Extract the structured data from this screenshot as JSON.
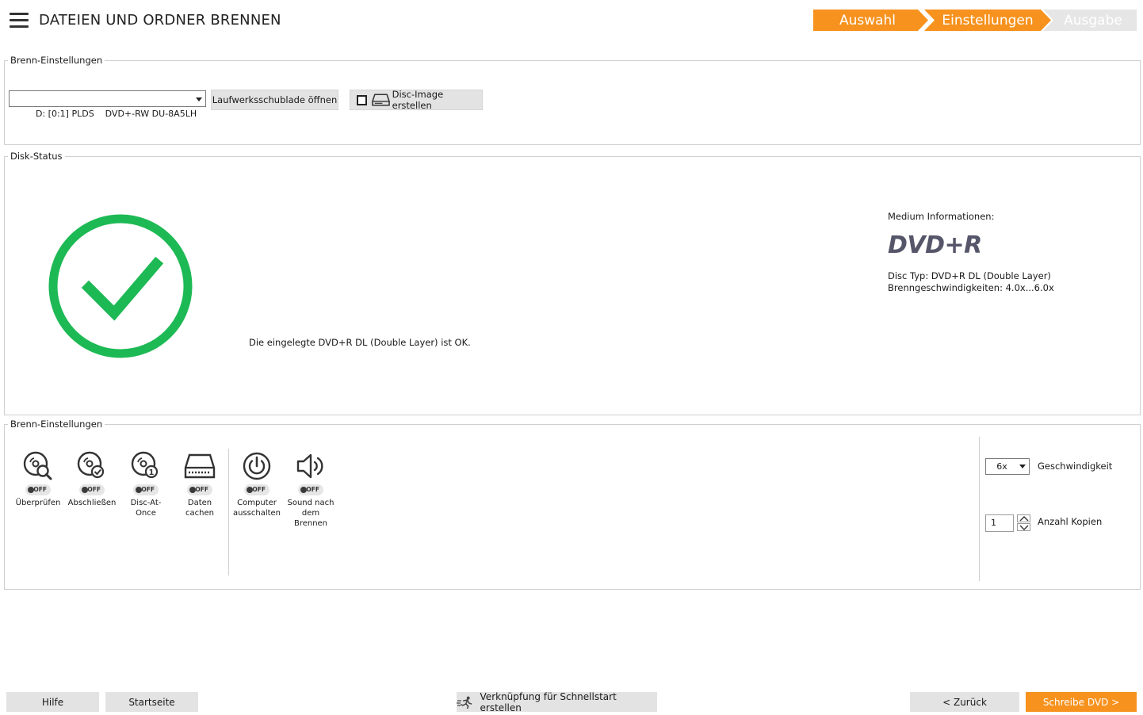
{
  "header": {
    "title": "DATEIEN UND ORDNER BRENNEN",
    "steps": [
      {
        "label": "Auswahl",
        "color": "#f7921e",
        "text_color": "#ffffff"
      },
      {
        "label": "Einstellungen",
        "color": "#f7921e",
        "text_color": "#ffffff"
      },
      {
        "label": "Ausgabe",
        "color": "#e6e6e6",
        "text_color": "#ffffff"
      }
    ]
  },
  "burn_settings_top": {
    "legend": "Brenn-Einstellungen",
    "drive": "D: [0:1] PLDS    DVD+-RW DU-8A5LH",
    "tray_button": "Laufwerksschublade öffnen",
    "disc_image_label": "Disc-Image erstellen",
    "disc_image_checked": false
  },
  "disk_status": {
    "legend": "Disk-Status",
    "ok_color": "#1db954",
    "message": "Die eingelegte DVD+R DL (Double Layer) ist OK.",
    "medium_title": "Medium Informationen:",
    "medium_type": "DVD+R",
    "disc_type": "Disc Typ: DVD+R DL (Double Layer)",
    "speeds": "Brenngeschwindigkeiten: 4.0x...6.0x"
  },
  "burn_settings_bottom": {
    "legend": "Brenn-Einstellungen",
    "options": [
      {
        "icon": "verify-disc-icon",
        "state": "OFF",
        "label": "Überprüfen"
      },
      {
        "icon": "finalize-disc-icon",
        "state": "OFF",
        "label": "Abschließen"
      },
      {
        "icon": "disc-at-once-icon",
        "state": "OFF",
        "label": "Disc-At-Once"
      },
      {
        "icon": "drive-cache-icon",
        "state": "OFF",
        "label": "Daten cachen"
      },
      {
        "icon": "power-icon",
        "state": "OFF",
        "label": "Computer ausschalten"
      },
      {
        "icon": "speaker-icon",
        "state": "OFF",
        "label": "Sound nach dem Brennen"
      }
    ],
    "speed_value": "6x",
    "speed_label": "Geschwindigkeit",
    "copies_value": "1",
    "copies_label": "Anzahl Kopien"
  },
  "footer": {
    "help": "Hilfe",
    "home": "Startseite",
    "shortcut": "Verknüpfung für Schnellstart erstellen",
    "back": "< Zurück",
    "write": "Schreibe DVD >",
    "accent": "#f7921e"
  }
}
